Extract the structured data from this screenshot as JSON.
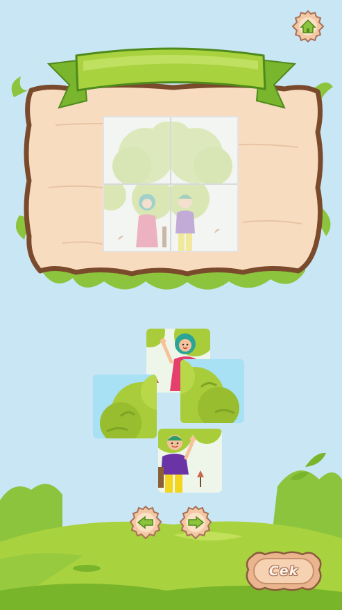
{
  "screen": "jigsaw-puzzle",
  "colors": {
    "sky": "#c9e6f4",
    "grass_light": "#a9d23f",
    "grass_dark": "#79b52b",
    "wood": "#f8dcc0",
    "wood_border": "#7a4a2c",
    "ribbon": "#8cc43d",
    "button_wood": "#f2c9a4"
  },
  "board": {
    "title": ""
  },
  "puzzle": {
    "rows": 2,
    "cols": 2,
    "slots": [
      "top-left",
      "top-right",
      "bottom-left",
      "bottom-right"
    ],
    "loose_pieces": [
      {
        "name": "girl-piece",
        "shows": "girl"
      },
      {
        "name": "tree-left-piece",
        "shows": "tree-left"
      },
      {
        "name": "tree-right-piece",
        "shows": "tree-right"
      },
      {
        "name": "boy-piece",
        "shows": "boy"
      }
    ]
  },
  "buttons": {
    "home_icon": "home-icon",
    "prev_icon": "arrow-left-icon",
    "next_icon": "arrow-right-icon",
    "check_label": "Cek"
  }
}
